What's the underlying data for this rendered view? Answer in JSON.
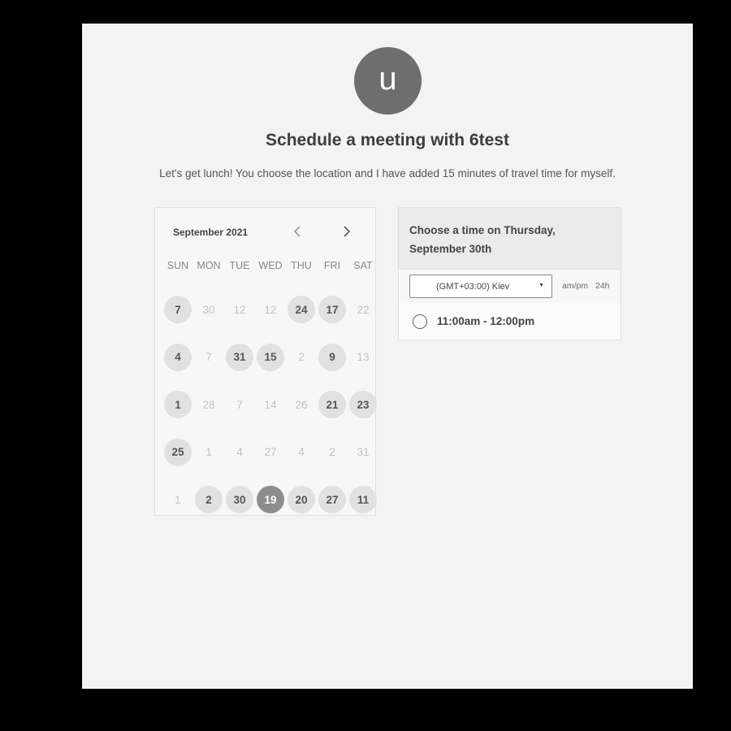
{
  "avatar": {
    "initial": "u"
  },
  "title": "Schedule a meeting with 6test",
  "subtitle": "Let's get lunch! You choose the location and I have added 15 minutes of travel time for myself.",
  "calendar": {
    "month": "September 2021",
    "prev_icon": "chevron-left-icon",
    "next_icon": "chevron-right-icon",
    "weekdays": [
      "SUN",
      "MON",
      "TUE",
      "WED",
      "THU",
      "FRI",
      "SAT"
    ],
    "weeks": [
      [
        {
          "label": "7",
          "state": "available"
        },
        {
          "label": "30",
          "state": "disabled"
        },
        {
          "label": "12",
          "state": "disabled"
        },
        {
          "label": "12",
          "state": "disabled"
        },
        {
          "label": "24",
          "state": "available"
        },
        {
          "label": "17",
          "state": "available"
        },
        {
          "label": "22",
          "state": "disabled"
        }
      ],
      [
        {
          "label": "4",
          "state": "available"
        },
        {
          "label": "7",
          "state": "disabled"
        },
        {
          "label": "31",
          "state": "available"
        },
        {
          "label": "15",
          "state": "available"
        },
        {
          "label": "2",
          "state": "disabled"
        },
        {
          "label": "9",
          "state": "available"
        },
        {
          "label": "13",
          "state": "disabled"
        }
      ],
      [
        {
          "label": "1",
          "state": "available"
        },
        {
          "label": "28",
          "state": "disabled"
        },
        {
          "label": "7",
          "state": "disabled"
        },
        {
          "label": "14",
          "state": "disabled"
        },
        {
          "label": "26",
          "state": "disabled"
        },
        {
          "label": "21",
          "state": "available"
        },
        {
          "label": "23",
          "state": "available"
        }
      ],
      [
        {
          "label": "25",
          "state": "available"
        },
        {
          "label": "1",
          "state": "disabled"
        },
        {
          "label": "4",
          "state": "disabled"
        },
        {
          "label": "27",
          "state": "disabled"
        },
        {
          "label": "4",
          "state": "disabled"
        },
        {
          "label": "2",
          "state": "disabled"
        },
        {
          "label": "31",
          "state": "disabled"
        }
      ],
      [
        {
          "label": "1",
          "state": "disabled"
        },
        {
          "label": "2",
          "state": "available"
        },
        {
          "label": "30",
          "state": "available"
        },
        {
          "label": "19",
          "state": "selected"
        },
        {
          "label": "20",
          "state": "available"
        },
        {
          "label": "27",
          "state": "available"
        },
        {
          "label": "11",
          "state": "available"
        }
      ]
    ]
  },
  "time_panel": {
    "header": "Choose a time on Thursday, September 30th",
    "timezone": "(GMT+03:00) Kiev",
    "format_ampm": "am/pm",
    "format_24h": "24h",
    "slots": [
      "11:00am - 12:00pm"
    ]
  }
}
